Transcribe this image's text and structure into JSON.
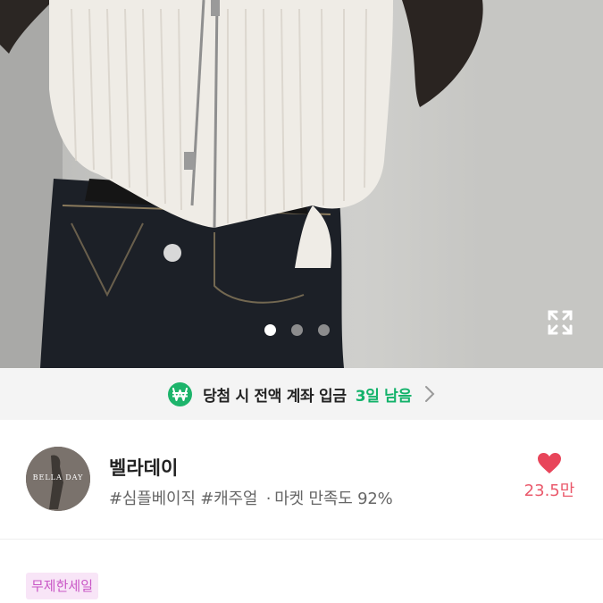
{
  "gallery": {
    "page_count": 3,
    "active_index": 0,
    "expand_icon": "expand-icon"
  },
  "banner": {
    "icon": "won-icon",
    "icon_text": "₩",
    "text": "당첨 시 전액 계좌 입금",
    "days_left": "3일 남음",
    "chevron": "chevron-right-icon",
    "accent": "#12b26a"
  },
  "shop": {
    "avatar_text": "BELLA DAY",
    "name": "벨라데이",
    "tag1": "#심플베이직",
    "tag2": "#캐주얼",
    "separator": "·",
    "satisfaction": "마켓 만족도 92%",
    "like_count": "23.5만",
    "like_color": "#ea5a6c"
  },
  "badge": {
    "label": "무제한세일",
    "color": "#c957c6"
  }
}
